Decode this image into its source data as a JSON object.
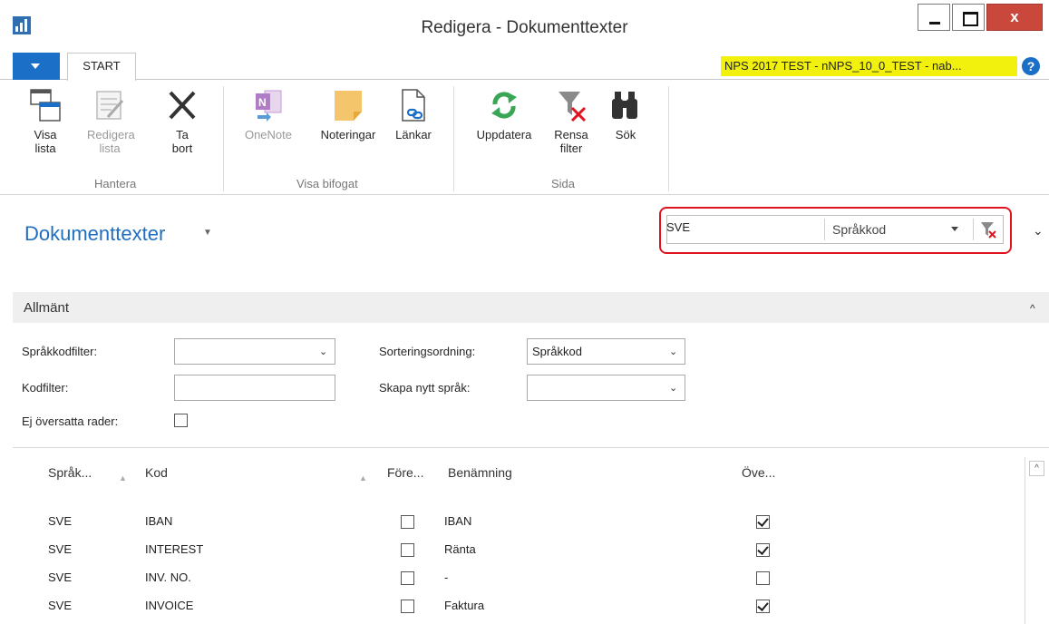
{
  "window": {
    "title": "Redigera - Dokumenttexter",
    "close_glyph": "x"
  },
  "ribbon_tabs": {
    "start": "START"
  },
  "company_label": "NPS 2017 TEST - nNPS_10_0_TEST - nab...",
  "help_glyph": "?",
  "ribbon": {
    "visa_lista": [
      "Visa",
      "lista"
    ],
    "redigera_lista": [
      "Redigera",
      "lista"
    ],
    "ta_bort": [
      "Ta",
      "bort"
    ],
    "hantera": "Hantera",
    "onenote": "OneNote",
    "noteringar": "Noteringar",
    "lankar": "Länkar",
    "visa_bifogat": "Visa bifogat",
    "uppdatera": "Uppdatera",
    "rensa_filter": [
      "Rensa",
      "filter"
    ],
    "sok": "Sök",
    "sida": "Sida"
  },
  "page": {
    "title": "Dokumenttexter"
  },
  "filter": {
    "value": "SVE",
    "field": "Språkkod"
  },
  "section": {
    "title": "Allmänt"
  },
  "form": {
    "sprakkodfilter_label": "Språkkodfilter:",
    "sprakkodfilter_value": "",
    "kodfilter_label": "Kodfilter:",
    "kodfilter_value": "",
    "ej_oversatta_label": "Ej översatta rader:",
    "ej_oversatta_checked": false,
    "sortering_label": "Sorteringsordning:",
    "sortering_value": "Språkkod",
    "skapa_label": "Skapa nytt språk:",
    "skapa_value": ""
  },
  "grid": {
    "columns": [
      "Språk...",
      "Kod",
      "Före...",
      "Benämning",
      "Öve..."
    ],
    "rows": [
      {
        "sprak": "SVE",
        "kod": "IBAN",
        "fore": false,
        "benamning": "IBAN",
        "ove": true
      },
      {
        "sprak": "SVE",
        "kod": "INTEREST",
        "fore": false,
        "benamning": "Ränta",
        "ove": true
      },
      {
        "sprak": "SVE",
        "kod": "INV. NO.",
        "fore": false,
        "benamning": "-",
        "ove": false
      },
      {
        "sprak": "SVE",
        "kod": "INVOICE",
        "fore": false,
        "benamning": "Faktura",
        "ove": true
      }
    ]
  }
}
